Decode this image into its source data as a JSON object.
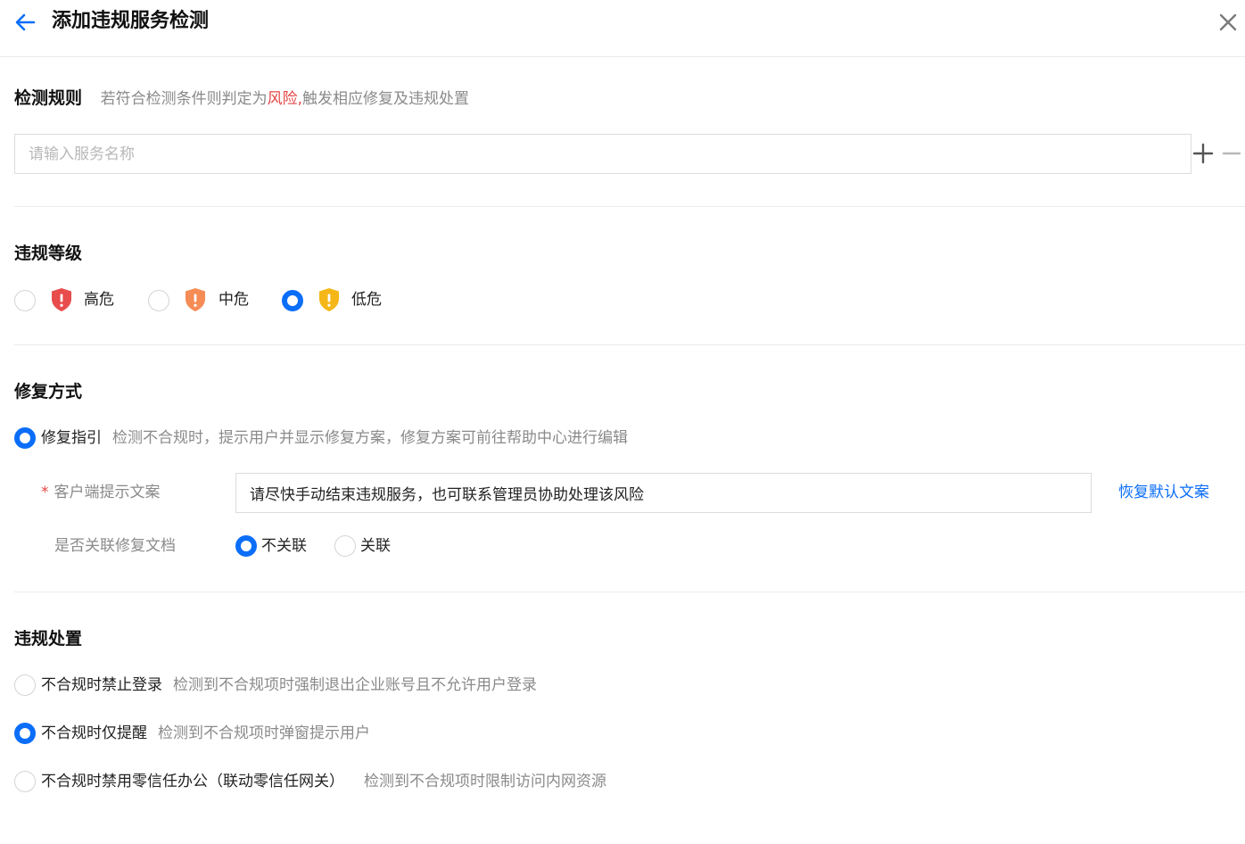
{
  "header": {
    "title": "添加违规服务检测"
  },
  "detection_rule": {
    "title": "检测规则",
    "desc_prefix": "若符合检测条件则判定为",
    "desc_risk": "风险,",
    "desc_suffix": "触发相应修复及违规处置",
    "input_placeholder": "请输入服务名称",
    "input_value": ""
  },
  "violation_level": {
    "title": "违规等级",
    "options": [
      {
        "label": "高危",
        "icon": "shield-alert-icon",
        "color": "#e84c4c",
        "selected": false
      },
      {
        "label": "中危",
        "icon": "shield-alert-icon",
        "color": "#f58c56",
        "selected": false
      },
      {
        "label": "低危",
        "icon": "shield-alert-icon",
        "color": "#f5b718",
        "selected": true
      }
    ]
  },
  "repair_method": {
    "title": "修复方式",
    "option_label": "修复指引",
    "option_desc": "检测不合规时，提示用户并显示修复方案，修复方案可前往帮助中心进行编辑",
    "client_tip_label": "客户端提示文案",
    "required_mark": "*",
    "client_tip_value": "请尽快手动结束违规服务，也可联系管理员协助处理该风险",
    "restore_link": "恢复默认文案",
    "link_doc_label": "是否关联修复文档",
    "link_doc_options": [
      {
        "label": "不关联",
        "selected": true
      },
      {
        "label": "关联",
        "selected": false
      }
    ]
  },
  "violation_handling": {
    "title": "违规处置",
    "options": [
      {
        "label": "不合规时禁止登录",
        "desc": "检测到不合规项时强制退出企业账号且不允许用户登录",
        "selected": false
      },
      {
        "label": "不合规时仅提醒",
        "desc": "检测到不合规项时弹窗提示用户",
        "selected": true
      },
      {
        "label": "不合规时禁用零信任办公（联动零信任网关）",
        "desc": "检测到不合规项时限制访问内网资源",
        "selected": false
      }
    ]
  },
  "colors": {
    "accent": "#0b6ef8",
    "risk_red": "#e54545"
  }
}
